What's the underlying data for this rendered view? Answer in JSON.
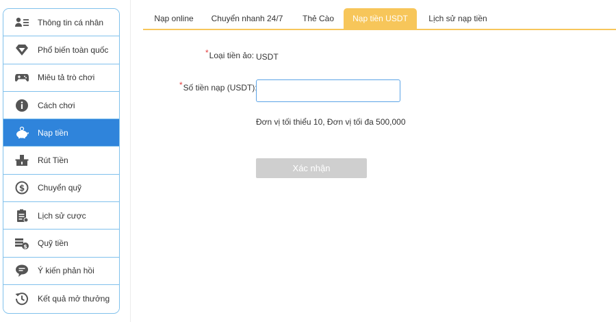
{
  "colors": {
    "sidebar_border": "#7fc0ec",
    "sidebar_active_bg": "#2f84db",
    "tab_accent": "#f7c65a",
    "required_mark": "#e33e3e",
    "input_border": "#5aa3e6",
    "button_disabled": "#cfcfcf"
  },
  "sidebar": {
    "items": [
      {
        "label": "Thông tin cá nhân",
        "icon": "user-card-icon"
      },
      {
        "label": "Phổ biến toàn quốc",
        "icon": "diamond-icon"
      },
      {
        "label": "Miêu tả trò chơi",
        "icon": "gamepad-icon"
      },
      {
        "label": "Cách chơi",
        "icon": "info-icon"
      },
      {
        "label": "Nạp tiền",
        "icon": "piggy-bank-icon",
        "active": true
      },
      {
        "label": "Rút Tiền",
        "icon": "withdraw-icon"
      },
      {
        "label": "Chuyển quỹ",
        "icon": "dollar-exchange-icon"
      },
      {
        "label": "Lịch sử cược",
        "icon": "clipboard-icon"
      },
      {
        "label": "Quỹ tiền",
        "icon": "coin-stack-icon"
      },
      {
        "label": "Ý kiến phản hồi",
        "icon": "chat-bubble-icon"
      },
      {
        "label": "Kết quả mở thưởng",
        "icon": "history-icon"
      }
    ]
  },
  "tabs": [
    {
      "label": "Nạp online"
    },
    {
      "label": "Chuyển nhanh 24/7"
    },
    {
      "label": "Thẻ Cào"
    },
    {
      "label": "Nạp tiền USDT",
      "active": true
    },
    {
      "label": "Lịch sử nạp tiền"
    }
  ],
  "form": {
    "required_mark": "*",
    "currency_label": "Loại tiền ảo:",
    "currency_value": "USDT",
    "amount_label": "Số tiền nạp (USDT):",
    "amount_value": "",
    "amount_placeholder": "",
    "hint": "Đơn vị tối thiểu 10, Đơn vị tối đa 500,000",
    "confirm_label": "Xác nhận"
  }
}
